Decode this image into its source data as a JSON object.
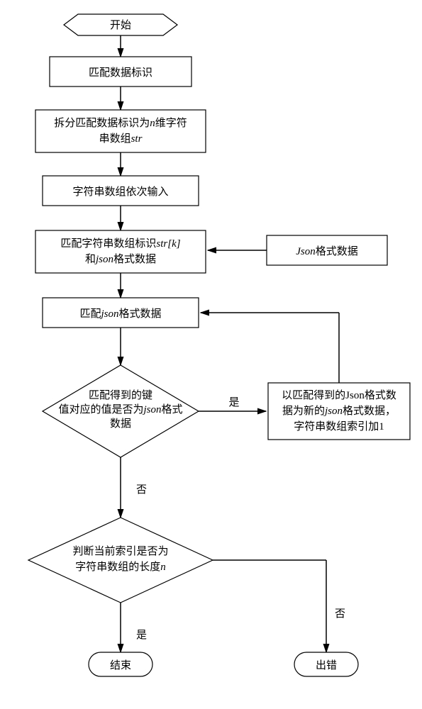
{
  "nodes": {
    "start": "开始",
    "p1": "匹配数据标识",
    "p2_line1": "拆分匹配数据标识为",
    "p2_line2": "维字符",
    "p2_line3": "串数组",
    "p3": "字符串数组依次输入",
    "p4_line1": "匹配字符串数组标识",
    "p4_line2": "和",
    "p4_line3": "格式数据",
    "side1": "格式数据",
    "p5_line1": "匹配",
    "p5_line2": "格式数据",
    "d1_line1": "匹配得到的键",
    "d1_line2": "值对应的值是否为",
    "d1_line3a": "格式",
    "d1_line3b": "数据",
    "side2_line1": "以匹配得到的Json格式数",
    "side2_line2": "据为新的",
    "side2_line2b": "格式数据，",
    "side2_line3": "字符串数组索引加1",
    "d2_line1": "判断当前索引是否为",
    "d2_line2": "字符串数组的长度",
    "end": "结束",
    "error": "出错"
  },
  "labels": {
    "yes": "是",
    "no": "否"
  },
  "italics": {
    "n": "n",
    "str": "str",
    "strk": "str[k]",
    "json": "json",
    "Json": "Json"
  }
}
